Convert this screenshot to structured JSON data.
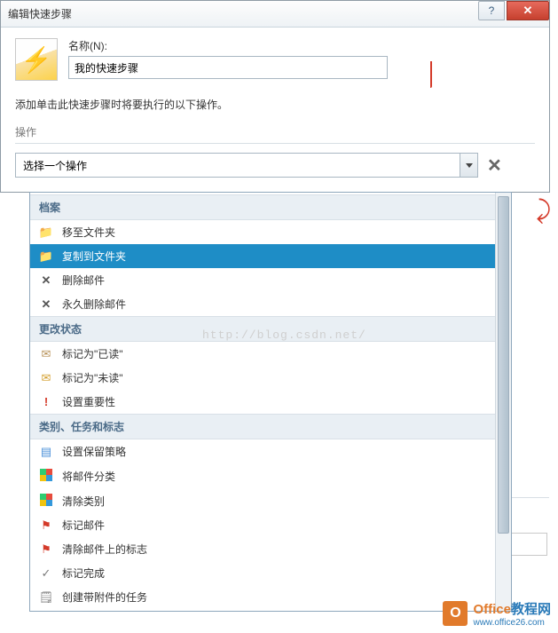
{
  "window": {
    "title": "编辑快速步骤"
  },
  "header": {
    "name_label": "名称(N):",
    "name_value": "我的快速步骤"
  },
  "instruction": "添加单击此快速步骤时将要执行的以下操作。",
  "section_label": "操作",
  "combo": {
    "placeholder": "选择一个操作"
  },
  "dropdown": {
    "groups": [
      {
        "label": "档案",
        "items": [
          {
            "icon": "folder-move-icon",
            "label": "移至文件夹"
          },
          {
            "icon": "folder-copy-icon",
            "label": "复制到文件夹",
            "selected": true
          },
          {
            "icon": "delete-x-icon",
            "label": "删除邮件"
          },
          {
            "icon": "delete-x-icon",
            "label": "永久删除邮件"
          }
        ]
      },
      {
        "label": "更改状态",
        "items": [
          {
            "icon": "envelope-open-icon",
            "label": "标记为\"已读\""
          },
          {
            "icon": "envelope-closed-icon",
            "label": "标记为\"未读\""
          },
          {
            "icon": "importance-icon",
            "label": "设置重要性"
          }
        ]
      },
      {
        "label": "类别、任务和标志",
        "items": [
          {
            "icon": "calendar-icon",
            "label": "设置保留策略"
          },
          {
            "icon": "category-icon",
            "label": "将邮件分类"
          },
          {
            "icon": "category-icon",
            "label": "清除类别"
          },
          {
            "icon": "flag-icon",
            "label": "标记邮件"
          },
          {
            "icon": "flag-icon",
            "label": "清除邮件上的标志"
          },
          {
            "icon": "check-icon",
            "label": "标记完成"
          },
          {
            "icon": "attachment-task-icon",
            "label": "创建带附件的任务"
          }
        ]
      }
    ]
  },
  "watermark": "http://blog.csdn.net/",
  "brand": {
    "name_a": "Office",
    "name_b": "教程网",
    "url": "www.office26.com"
  }
}
